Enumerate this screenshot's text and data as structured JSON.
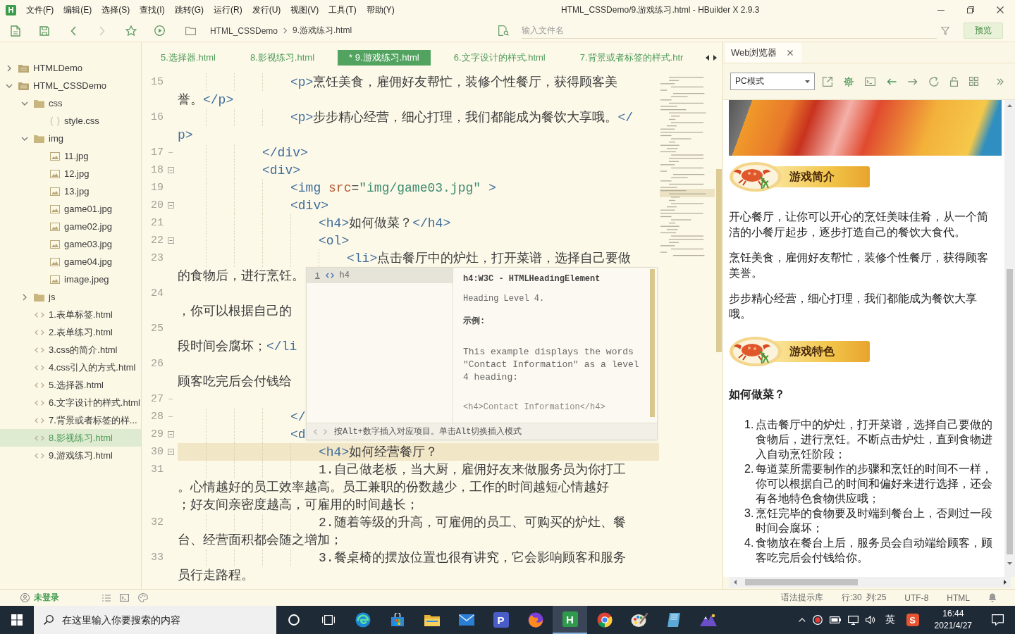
{
  "window": {
    "logo": "H",
    "menu": [
      "文件(F)",
      "编辑(E)",
      "选择(S)",
      "查找(I)",
      "跳转(G)",
      "运行(R)",
      "发行(U)",
      "视图(V)",
      "工具(T)",
      "帮助(Y)"
    ],
    "title": "HTML_CSSDemo/9.游戏练习.html - HBuilder X 2.9.3"
  },
  "toolbar": {
    "buttons": [
      {
        "kind": "new-file",
        "disabled": false
      },
      {
        "kind": "save",
        "disabled": false
      },
      {
        "kind": "back",
        "disabled": false
      },
      {
        "kind": "forward",
        "disabled": true
      },
      {
        "kind": "favorite",
        "disabled": false
      },
      {
        "kind": "run",
        "disabled": false
      }
    ],
    "breadcrumb": [
      "HTML_CSSDemo",
      "9.游戏练习.html"
    ],
    "search": {
      "placeholder": "输入文件名"
    },
    "preview_button": "预览"
  },
  "sidebar": {
    "items": [
      {
        "kind": "project",
        "label": "HTMLDemo",
        "expanded": false,
        "selected": false
      },
      {
        "kind": "project",
        "label": "HTML_CSSDemo",
        "expanded": true,
        "selected": false,
        "children": [
          {
            "kind": "folder",
            "label": "css",
            "expanded": true,
            "selected": false,
            "children": [
              {
                "kind": "stylesheet",
                "label": "style.css",
                "selected": false
              }
            ]
          },
          {
            "kind": "folder",
            "label": "img",
            "expanded": true,
            "selected": false,
            "children": [
              {
                "kind": "image",
                "label": "11.jpg",
                "selected": false
              },
              {
                "kind": "image",
                "label": "12.jpg",
                "selected": false
              },
              {
                "kind": "image",
                "label": "13.jpg",
                "selected": false
              },
              {
                "kind": "image",
                "label": "game01.jpg",
                "selected": false
              },
              {
                "kind": "image",
                "label": "game02.jpg",
                "selected": false
              },
              {
                "kind": "image",
                "label": "game03.jpg",
                "selected": false
              },
              {
                "kind": "image",
                "label": "game04.jpg",
                "selected": false
              },
              {
                "kind": "image",
                "label": "image.jpeg",
                "selected": false
              }
            ]
          },
          {
            "kind": "folder",
            "label": "js",
            "expanded": false,
            "selected": false
          },
          {
            "kind": "page",
            "label": "1.表单标签.html",
            "selected": false
          },
          {
            "kind": "page",
            "label": "2.表单练习.html",
            "selected": false
          },
          {
            "kind": "page",
            "label": "3.css的简介.html",
            "selected": false
          },
          {
            "kind": "page",
            "label": "4.css引入的方式.html",
            "selected": false
          },
          {
            "kind": "page",
            "label": "5.选择器.html",
            "selected": false
          },
          {
            "kind": "page",
            "label": "6.文字设计的样式.html",
            "selected": false
          },
          {
            "kind": "page",
            "label": "7.背景或者标签的样...",
            "selected": false
          },
          {
            "kind": "page",
            "label": "8.影视练习.html",
            "selected": true
          },
          {
            "kind": "page",
            "label": "9.游戏练习.html",
            "selected": false
          }
        ]
      }
    ]
  },
  "editor": {
    "tabs": [
      {
        "label": "5.选择器.html",
        "selected": false
      },
      {
        "label": "8.影视练习.html",
        "selected": false
      },
      {
        "label": "* 9.游戏练习.html",
        "selected": true
      },
      {
        "label": "6.文字设计的样式.html",
        "selected": false
      },
      {
        "label": "7.背景或者标签的样式.htr",
        "selected": false
      }
    ],
    "lines": [
      {
        "number": "15",
        "current": false,
        "foldable": false,
        "fold_end": false,
        "rows": [
          "\t\t\t\t<p>烹饪美食，雇佣好友帮忙，装修个性餐厅，获得顾客美",
          "誉。</p>"
        ]
      },
      {
        "number": "16",
        "current": false,
        "foldable": false,
        "fold_end": false,
        "rows": [
          "\t\t\t\t<p>步步精心经营，细心打理，我们都能成为餐饮大享哦。</",
          "p>"
        ]
      },
      {
        "number": "17",
        "current": false,
        "foldable": false,
        "fold_end": true,
        "rows": [
          "\t\t\t</div>"
        ]
      },
      {
        "number": "18",
        "current": false,
        "foldable": true,
        "fold_end": false,
        "rows": [
          "\t\t\t<div>"
        ]
      },
      {
        "number": "19",
        "current": false,
        "foldable": false,
        "fold_end": false,
        "rows": [
          "\t\t\t\t<img src=\"img/game03.jpg\" >"
        ]
      },
      {
        "number": "20",
        "current": false,
        "foldable": true,
        "fold_end": false,
        "rows": [
          "\t\t\t\t<div>"
        ]
      },
      {
        "number": "21",
        "current": false,
        "foldable": false,
        "fold_end": false,
        "rows": [
          "\t\t\t\t\t<h4>如何做菜？</h4>"
        ]
      },
      {
        "number": "22",
        "current": false,
        "foldable": true,
        "fold_end": false,
        "rows": [
          "\t\t\t\t\t<ol>"
        ]
      },
      {
        "number": "23",
        "current": false,
        "foldable": false,
        "fold_end": false,
        "rows": [
          "\t\t\t\t\t\t<li>点击餐厅中的炉灶，打开菜谱，选择自己要做",
          "的食物后，进行烹饪。"
        ]
      },
      {
        "number": "24",
        "current": false,
        "foldable": false,
        "fold_end": false,
        "rows": [
          null,
          "，你可以根据自己的"
        ]
      },
      {
        "number": "25",
        "current": false,
        "foldable": false,
        "fold_end": false,
        "rows": [
          null,
          "段时间会腐坏；</li"
        ]
      },
      {
        "number": "26",
        "current": false,
        "foldable": false,
        "fold_end": false,
        "rows": [
          null,
          "顾客吃完后会付钱给"
        ]
      },
      {
        "number": "27",
        "current": false,
        "foldable": false,
        "fold_end": true
      },
      {
        "number": "28",
        "current": false,
        "foldable": false,
        "fold_end": true,
        "rows": [
          "\t\t\t\t</"
        ]
      },
      {
        "number": "29",
        "current": false,
        "foldable": true,
        "fold_end": false,
        "rows": [
          "\t\t\t\t<d"
        ]
      },
      {
        "number": "30",
        "current": true,
        "foldable": true,
        "fold_end": false,
        "rows": [
          "\t\t\t\t\t<h4>如何经营餐厅？"
        ]
      },
      {
        "number": "31",
        "current": false,
        "foldable": false,
        "fold_end": false,
        "rows": [
          "\t\t\t\t\t1.自己做老板，当大厨，雇佣好友来做服务员为你打工",
          "。心情越好的员工效率越高。员工兼职的份数越少，工作的时间越短心情越好",
          "；好友间亲密度越高，可雇用的时间越长；"
        ]
      },
      {
        "number": "32",
        "current": false,
        "foldable": false,
        "fold_end": false,
        "rows": [
          "\t\t\t\t\t2.随着等级的升高，可雇佣的员工、可购买的炉灶、餐",
          "台、经营面积都会随之增加；"
        ]
      },
      {
        "number": "33",
        "current": false,
        "foldable": false,
        "fold_end": false,
        "rows": [
          "\t\t\t\t\t3.餐桌椅的摆放位置也很有讲究，它会影响顾客和服务",
          "员行走路程。"
        ]
      }
    ],
    "popup": {
      "suggestions": [
        {
          "shortcut": "1",
          "label": "h4",
          "selected": true
        }
      ],
      "doc": {
        "title": "h4:W3C - HTMLHeadingElement",
        "summary": "Heading Level 4.",
        "example_heading": "示例:",
        "example_text": "This example displays the words \"Contact Information\" as a level 4 heading:",
        "example_code": "<h4>Contact Information</h4>"
      },
      "hint": "按Alt+数字插入对应项目。单击Alt切换插入模式"
    }
  },
  "browser_panel": {
    "tab": "Web浏览器",
    "mode": "PC模式",
    "page": [
      {
        "kind": "image"
      },
      {
        "kind": "banner",
        "text": "游戏简介"
      },
      {
        "kind": "paragraph",
        "text": "开心餐厅，让你可以开心的烹饪美味佳肴，从一个简洁的小餐厅起步，逐步打造自己的餐饮大食代。"
      },
      {
        "kind": "paragraph",
        "text": "烹饪美食，雇佣好友帮忙，装修个性餐厅，获得顾客美誉。"
      },
      {
        "kind": "paragraph",
        "text": "步步精心经营，细心打理，我们都能成为餐饮大享哦。"
      },
      {
        "kind": "banner",
        "text": "游戏特色"
      },
      {
        "kind": "heading",
        "text": "如何做菜？"
      },
      {
        "kind": "list",
        "items": [
          {
            "number": "1.",
            "text": "点击餐厅中的炉灶，打开菜谱，选择自己要做的食物后，进行烹饪。不断点击炉灶，直到食物进入自动烹饪阶段；"
          },
          {
            "number": "2.",
            "text": "每道菜所需要制作的步骤和烹饪的时间不一样，你可以根据自己的时间和偏好来进行选择，还会有各地特色食物供应哦；"
          },
          {
            "number": "3.",
            "text": "烹饪完毕的食物要及时端到餐台上，否则过一段时间会腐坏；"
          },
          {
            "number": "4.",
            "text": "食物放在餐台上后，服务员会自动端给顾客，顾客吃完后会付钱给你。"
          }
        ]
      }
    ]
  },
  "status_bar": {
    "user": "未登录",
    "hint_library": "语法提示库",
    "line": "行:30",
    "column": "列:25",
    "encoding": "UTF-8",
    "language": "HTML"
  },
  "taskbar": {
    "search": {
      "placeholder": "在这里输入你要搜索的内容"
    },
    "apps": [
      {
        "kind": "ring",
        "active": false
      },
      {
        "kind": "task-view",
        "active": false
      },
      {
        "kind": "browser",
        "active": false
      },
      {
        "kind": "store",
        "active": false
      },
      {
        "kind": "folder",
        "active": false
      },
      {
        "kind": "mail",
        "active": false
      },
      {
        "kind": "letter",
        "label": "P",
        "color": "#4a5cc8",
        "active": false
      },
      {
        "kind": "fox",
        "active": false
      },
      {
        "kind": "letter",
        "label": "H",
        "color": "#2f9a4c",
        "active": true
      },
      {
        "kind": "chrome",
        "active": false
      },
      {
        "kind": "paint",
        "active": false
      },
      {
        "kind": "notebook",
        "active": false
      },
      {
        "kind": "mountain",
        "active": false
      }
    ],
    "tray": {
      "input_method": "英",
      "app_letter": "S",
      "time": "16:44",
      "date": "2021/4/27"
    }
  }
}
